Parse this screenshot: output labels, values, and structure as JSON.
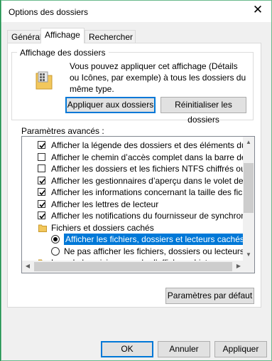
{
  "window": {
    "title": "Options des dossiers",
    "close_glyph": "✕"
  },
  "tabs": [
    "Général",
    "Affichage",
    "Rechercher"
  ],
  "folder_views": {
    "group_label": "Affichage des dossiers",
    "description": "Vous pouvez appliquer cet affichage (Détails ou Icônes, par exemple) à tous les dossiers du même type.",
    "apply_button": "Appliquer aux dossiers",
    "reset_button": "Réinitialiser les dossiers"
  },
  "advanced": {
    "label": "Paramètres avancés :",
    "items": [
      {
        "type": "checkbox",
        "checked": true,
        "label": "Afficher la légende des dossiers et des éléments du Burea"
      },
      {
        "type": "checkbox",
        "checked": false,
        "label": "Afficher le chemin d’accès complet dans la barre de titre"
      },
      {
        "type": "checkbox",
        "checked": false,
        "label": "Afficher les dossiers et les fichiers NTFS chiffrés ou compre"
      },
      {
        "type": "checkbox",
        "checked": true,
        "label": "Afficher les gestionnaires d’aperçu dans le volet de visual"
      },
      {
        "type": "checkbox",
        "checked": true,
        "label": "Afficher les informations concernant la taille des fichiers d"
      },
      {
        "type": "checkbox",
        "checked": true,
        "label": "Afficher les lettres de lecteur"
      },
      {
        "type": "checkbox",
        "checked": true,
        "label": "Afficher les notifications du fournisseur de synchronisation"
      },
      {
        "type": "folder",
        "label": "Fichiers et dossiers cachés"
      },
      {
        "type": "radio",
        "checked": true,
        "selected": true,
        "label": "Afficher les fichiers, dossiers et lecteurs cachés"
      },
      {
        "type": "radio",
        "checked": false,
        "label": "Ne pas afficher les fichiers, dossiers ou lecteurs cach"
      },
      {
        "type": "folder",
        "label": "Lors de la saisie en mode d’affichage Liste"
      }
    ],
    "restore_button": "Paramètres par défaut"
  },
  "footer": {
    "ok": "OK",
    "cancel": "Annuler",
    "apply": "Appliquer"
  }
}
